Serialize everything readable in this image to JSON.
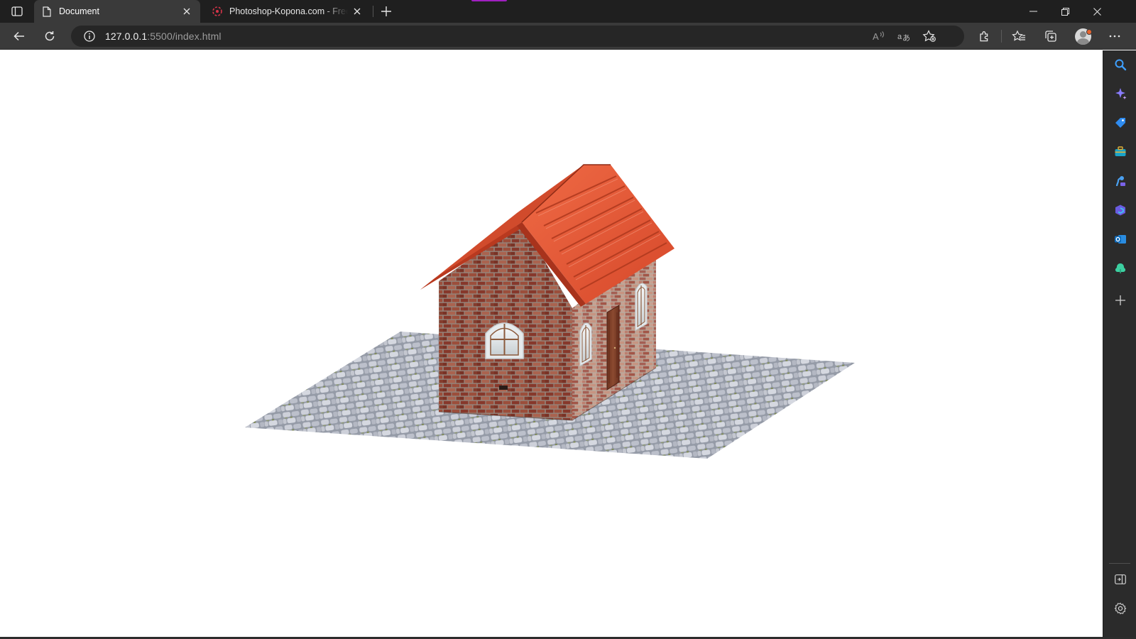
{
  "browser": {
    "tabs": [
      {
        "title": "Document",
        "active": true,
        "favicon": "page-icon"
      },
      {
        "title": "Photoshop-Kopona.com - Free Photoshop",
        "active": false,
        "favicon": "kopona-logo-icon"
      }
    ],
    "address_bar": {
      "host": "127.0.0.1",
      "path": ":5500/index.html"
    },
    "window_controls": [
      "minimize-icon",
      "restore-icon",
      "close-icon"
    ],
    "toolbar_icons": [
      "read-aloud-icon",
      "translate-icon",
      "add-favorite-icon",
      "extensions-icon",
      "favorites-icon",
      "collections-icon",
      "profile-icon",
      "more-icon"
    ],
    "sidebar_icons": [
      "search-icon",
      "copilot-icon",
      "shopping-icon",
      "tools-icon",
      "games-icon",
      "microsoft-365-icon",
      "outlook-icon",
      "drop-icon",
      "add-icon",
      "hide-sidebar-icon",
      "settings-icon"
    ]
  },
  "page": {
    "scene": "3d-house",
    "scene_description_visible": false,
    "colors": {
      "roof": "#e0532f",
      "brick": "#9a4a3a",
      "ground": "#b9bcc6",
      "moss": "#7d8a3a",
      "door": "#7a3c26",
      "window_frame": "#e8ecef"
    }
  }
}
